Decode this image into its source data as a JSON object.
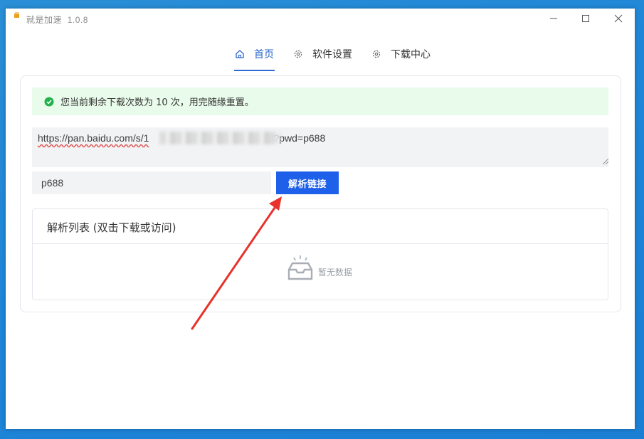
{
  "window": {
    "title": "就是加速",
    "version": "1.0.8"
  },
  "nav": {
    "tabs": [
      {
        "label": "首页",
        "icon": "home-icon",
        "active": true
      },
      {
        "label": "软件设置",
        "icon": "gear-icon",
        "active": false
      },
      {
        "label": "下载中心",
        "icon": "gear-icon",
        "active": false
      }
    ]
  },
  "alert": {
    "text": "您当前剩余下载次数为 10 次，用完随缘重置。",
    "icon": "check-circle-icon",
    "color": "#22b14c"
  },
  "url_input": {
    "value_visible_prefix": "https://pan.baidu.com/s/1",
    "value_visible_suffix": "?pwd=p688"
  },
  "pwd_input": {
    "value": "p688"
  },
  "parse_button": {
    "label": "解析链接",
    "color": "#1f60ea"
  },
  "list": {
    "title": "解析列表 (双击下载或访问)",
    "empty_text": "暂无数据"
  },
  "colors": {
    "accent": "#2f6bd1",
    "desktop": "#1f86d8",
    "annotation_arrow": "#e8322b"
  }
}
